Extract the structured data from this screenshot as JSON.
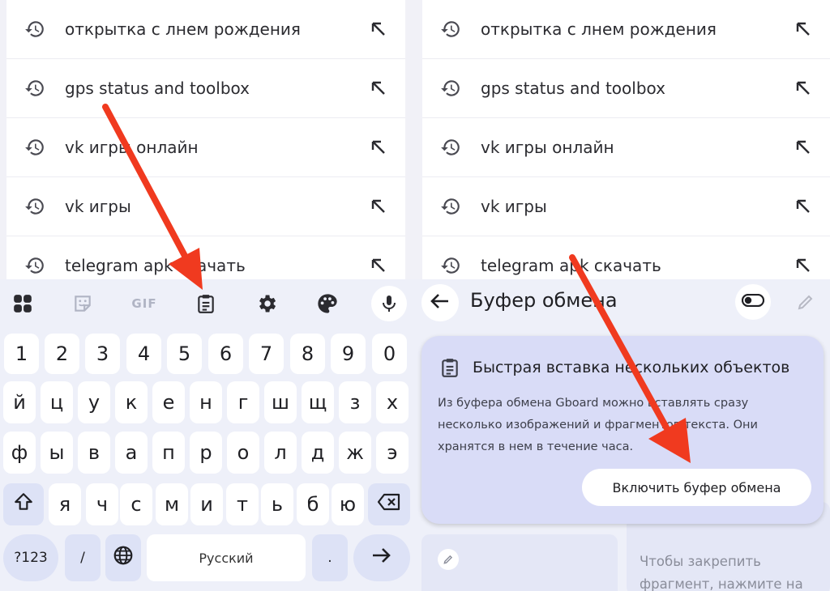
{
  "suggestions": [
    {
      "text": "открытка с лнем рождения"
    },
    {
      "text": "gps status and toolbox"
    },
    {
      "text": "vk игры онлайн"
    },
    {
      "text": "vk игры"
    },
    {
      "text": "telegram apk скачать"
    }
  ],
  "toolbar": {
    "gif_label": "GIF"
  },
  "keyboard": {
    "row1": [
      "1",
      "2",
      "3",
      "4",
      "5",
      "6",
      "7",
      "8",
      "9",
      "0"
    ],
    "row2": [
      "й",
      "ц",
      "у",
      "к",
      "е",
      "н",
      "г",
      "ш",
      "щ",
      "з",
      "х"
    ],
    "row3": [
      "ф",
      "ы",
      "в",
      "а",
      "п",
      "р",
      "о",
      "л",
      "д",
      "ж",
      "э"
    ],
    "row4": [
      "я",
      "ч",
      "с",
      "м",
      "и",
      "т",
      "ь",
      "б",
      "ю"
    ],
    "symbols_label": "?123",
    "slash_label": "/",
    "space_label": "Русский",
    "period_label": "."
  },
  "clipboard": {
    "title": "Буфер обмена",
    "tip_title": "Быстрая вставка нескольких объектов",
    "tip_text": "Из буфера обмена Gboard можно вставлять сразу несколько изображений и фрагментов текста. Они хранятся в нем в течение часа.",
    "enable_button": "Включить буфер обмена",
    "pin_hint": "Чтобы закрепить фрагмент, нажмите на"
  },
  "colors": {
    "accent_arrow": "#f03a1f",
    "keyboard_bg": "#eef0f9",
    "tip_card_bg": "#d9dcf7",
    "function_key_bg": "#dde2f6"
  },
  "icons": [
    "history-icon",
    "north-west-arrow-icon",
    "apps-grid-icon",
    "sticker-icon",
    "clipboard-icon",
    "gear-icon",
    "palette-icon",
    "mic-icon",
    "shift-icon",
    "backspace-icon",
    "globe-icon",
    "enter-arrow-icon",
    "back-arrow-icon",
    "toggle-icon",
    "pencil-icon"
  ]
}
